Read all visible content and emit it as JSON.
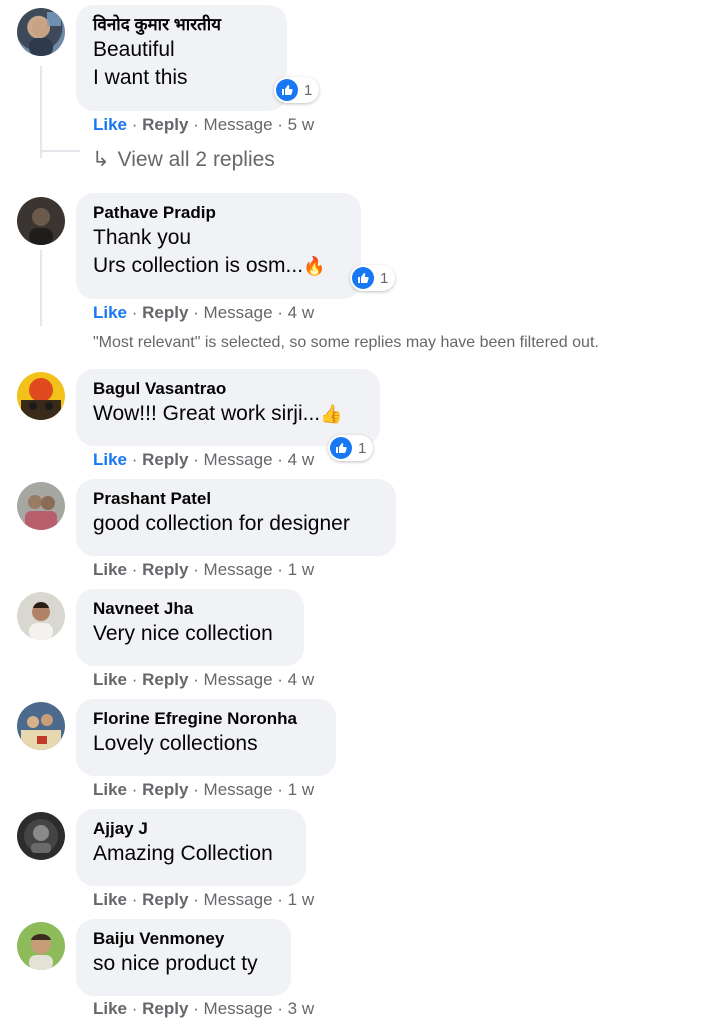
{
  "action_labels": {
    "like": "Like",
    "reply": "Reply",
    "message": "Message"
  },
  "comments": [
    {
      "author": "विनोद कुमार भारतीय",
      "lines": [
        "Beautiful",
        "I want this"
      ],
      "reactions": "1",
      "time": "5 w",
      "liked": true
    },
    {
      "author": "Pathave Pradip",
      "lines": [
        "Thank you",
        "Urs collection is osm..."
      ],
      "emoji": "fire",
      "reactions": "1",
      "time": "4 w",
      "liked": true
    },
    {
      "author": "Bagul Vasantrao",
      "lines": [
        "Wow!!! Great work sirji..."
      ],
      "emoji": "thumbs-up",
      "reactions": "1",
      "time": "4 w",
      "liked": true
    },
    {
      "author": "Prashant Patel",
      "lines": [
        "good collection for designer"
      ],
      "time": "1 w",
      "liked": false
    },
    {
      "author": "Navneet Jha",
      "lines": [
        "Very nice collection"
      ],
      "time": "4 w",
      "liked": false
    },
    {
      "author": "Florine Efregine Noronha",
      "lines": [
        "Lovely collections"
      ],
      "time": "1 w",
      "liked": false
    },
    {
      "author": "Ajjay J",
      "lines": [
        "Amazing Collection"
      ],
      "time": "1 w",
      "liked": false
    },
    {
      "author": "Baiju Venmoney",
      "lines": [
        "so nice product ty"
      ],
      "time": "3 w",
      "liked": false
    }
  ],
  "view_replies": "View all 2 replies",
  "filter_note": "\"Most relevant\" is selected, so some replies may have been filtered out.",
  "colors": {
    "link_blue": "#1877f2",
    "bubble_bg": "#f0f2f5",
    "meta_grey": "#65676b"
  }
}
